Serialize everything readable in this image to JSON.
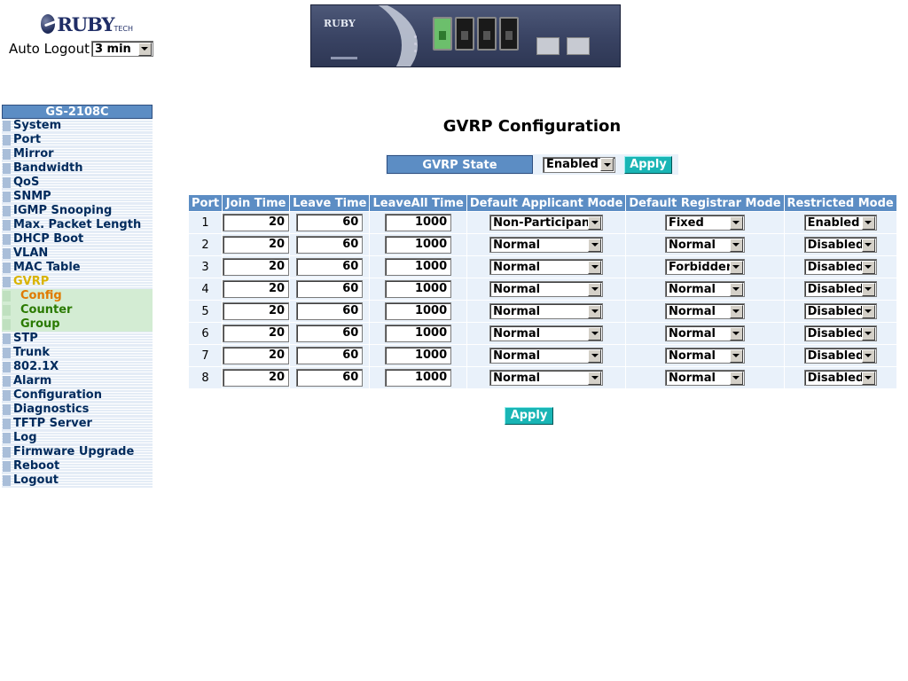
{
  "header": {
    "logo_text": "RUBY",
    "logo_suffix": "TECH",
    "autologout_label": "Auto Logout",
    "autologout_value": "3 min"
  },
  "device": {
    "brand": "RUBY",
    "active_port_color": "#6cbf6c"
  },
  "sidebar": {
    "title": "GS-2108C",
    "items": [
      {
        "label": "System"
      },
      {
        "label": "Port"
      },
      {
        "label": "Mirror"
      },
      {
        "label": "Bandwidth"
      },
      {
        "label": "QoS"
      },
      {
        "label": "SNMP"
      },
      {
        "label": "IGMP Snooping"
      },
      {
        "label": "Max. Packet Length"
      },
      {
        "label": "DHCP Boot"
      },
      {
        "label": "VLAN"
      },
      {
        "label": "MAC Table"
      },
      {
        "label": "GVRP",
        "active": true
      },
      {
        "label": "Config",
        "sub": true,
        "current": true
      },
      {
        "label": "Counter",
        "sub": true
      },
      {
        "label": "Group",
        "sub": true
      },
      {
        "label": "STP"
      },
      {
        "label": "Trunk"
      },
      {
        "label": "802.1X"
      },
      {
        "label": "Alarm"
      },
      {
        "label": "Configuration"
      },
      {
        "label": "Diagnostics"
      },
      {
        "label": "TFTP Server"
      },
      {
        "label": "Log"
      },
      {
        "label": "Firmware Upgrade"
      },
      {
        "label": "Reboot"
      },
      {
        "label": "Logout"
      }
    ]
  },
  "main": {
    "title": "GVRP Configuration",
    "state_label": "GVRP State",
    "state_value": "Enabled",
    "state_apply": "Apply",
    "apply_label": "Apply",
    "columns": [
      "Port",
      "Join Time",
      "Leave Time",
      "LeaveAll Time",
      "Default Applicant Mode",
      "Default Registrar Mode",
      "Restricted Mode"
    ],
    "rows": [
      {
        "port": "1",
        "join": "20",
        "leave": "60",
        "leaveall": "1000",
        "applicant": "Non-Participant",
        "registrar": "Fixed",
        "restricted": "Enabled"
      },
      {
        "port": "2",
        "join": "20",
        "leave": "60",
        "leaveall": "1000",
        "applicant": "Normal",
        "registrar": "Normal",
        "restricted": "Disabled"
      },
      {
        "port": "3",
        "join": "20",
        "leave": "60",
        "leaveall": "1000",
        "applicant": "Normal",
        "registrar": "Forbidden",
        "restricted": "Disabled"
      },
      {
        "port": "4",
        "join": "20",
        "leave": "60",
        "leaveall": "1000",
        "applicant": "Normal",
        "registrar": "Normal",
        "restricted": "Disabled"
      },
      {
        "port": "5",
        "join": "20",
        "leave": "60",
        "leaveall": "1000",
        "applicant": "Normal",
        "registrar": "Normal",
        "restricted": "Disabled"
      },
      {
        "port": "6",
        "join": "20",
        "leave": "60",
        "leaveall": "1000",
        "applicant": "Normal",
        "registrar": "Normal",
        "restricted": "Disabled"
      },
      {
        "port": "7",
        "join": "20",
        "leave": "60",
        "leaveall": "1000",
        "applicant": "Normal",
        "registrar": "Normal",
        "restricted": "Disabled"
      },
      {
        "port": "8",
        "join": "20",
        "leave": "60",
        "leaveall": "1000",
        "applicant": "Normal",
        "registrar": "Normal",
        "restricted": "Disabled"
      }
    ]
  }
}
